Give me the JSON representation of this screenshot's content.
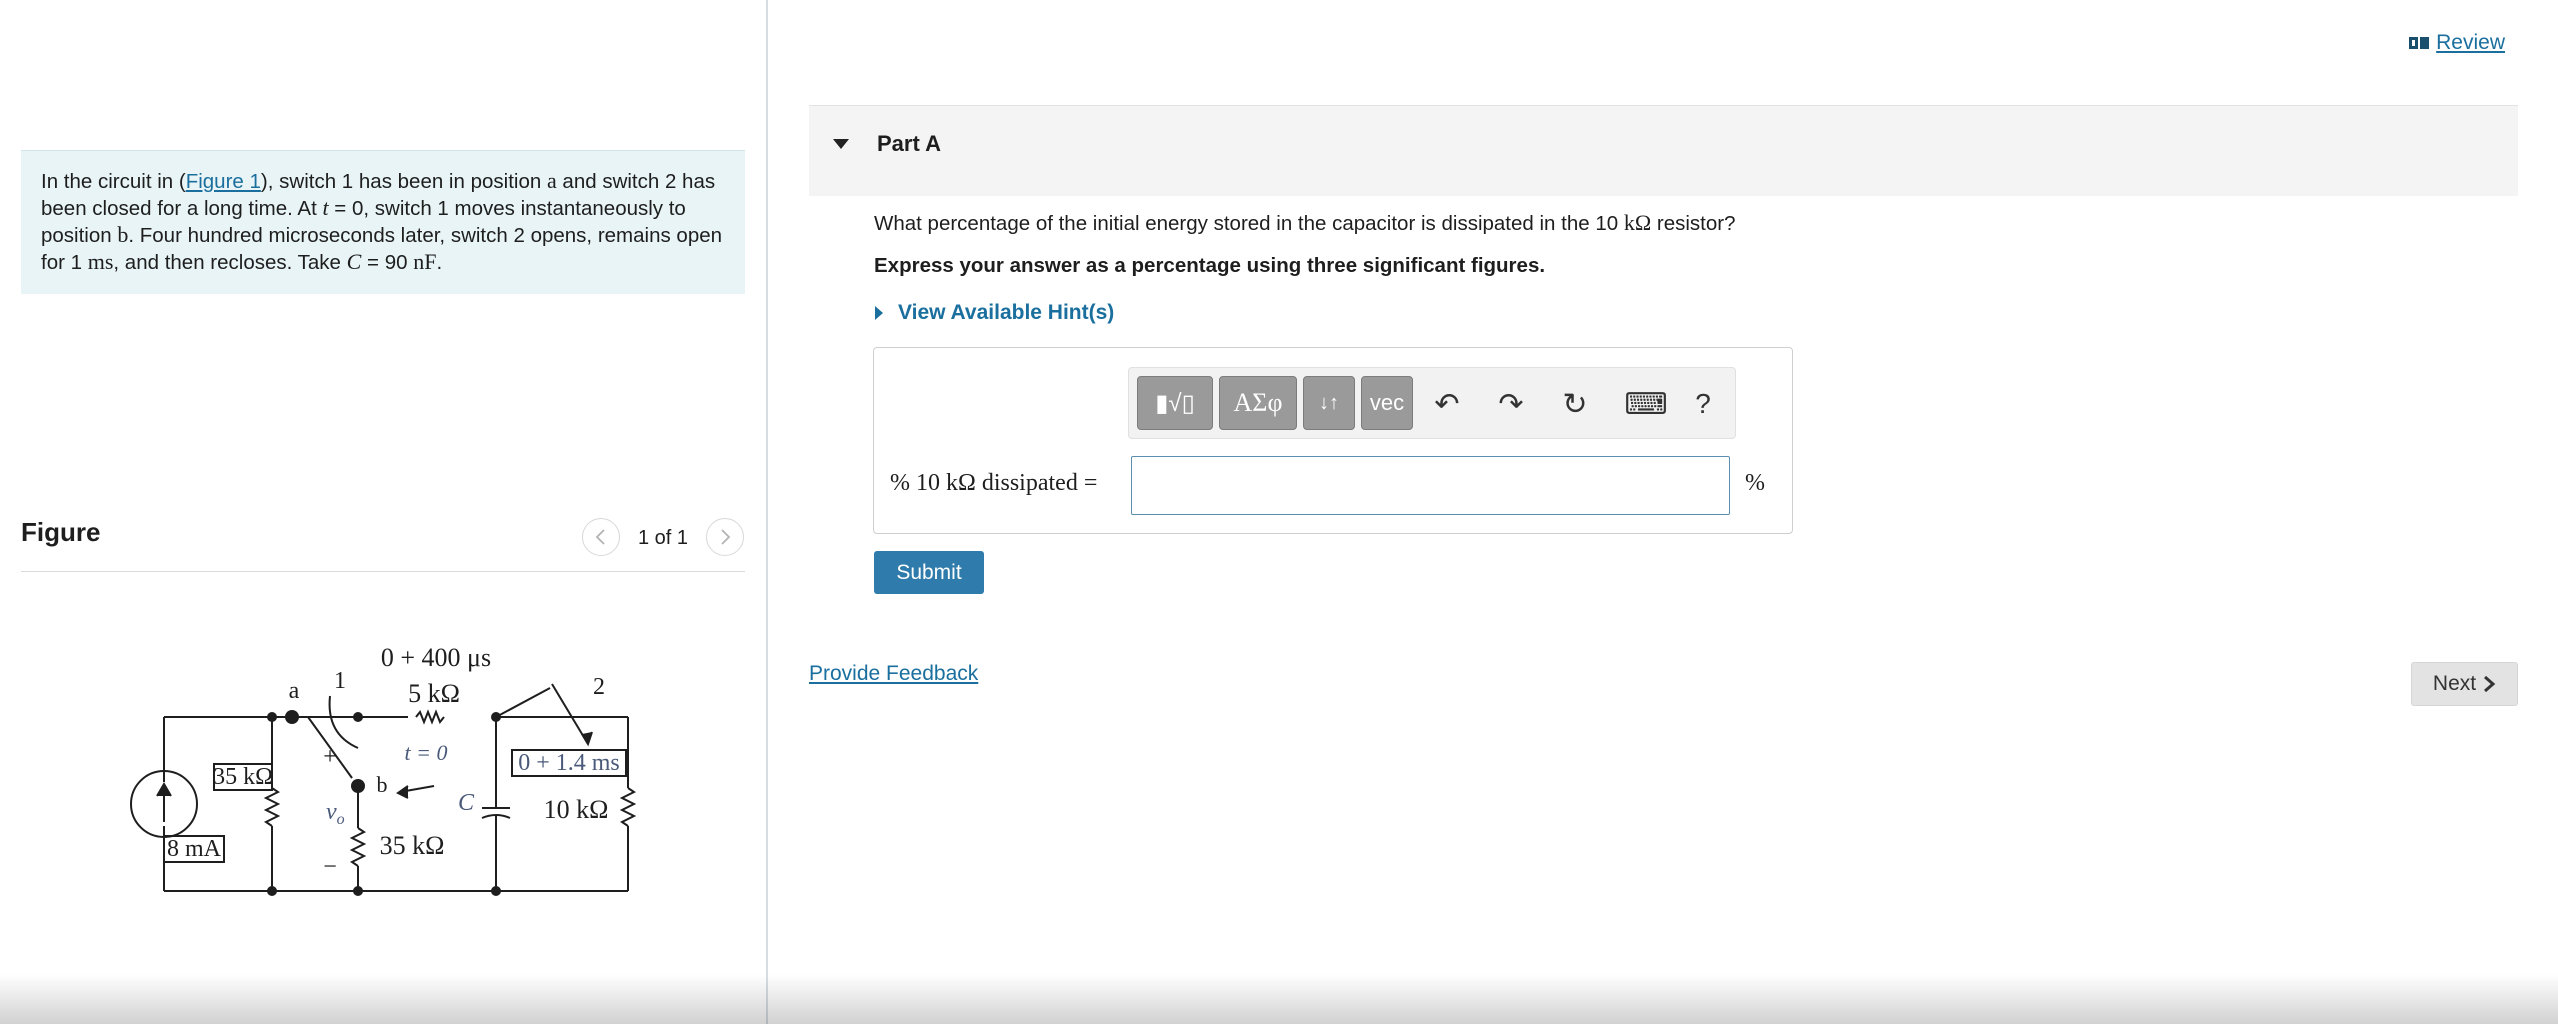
{
  "problem": {
    "text_1": "In the circuit in (",
    "figure_link": "Figure 1",
    "text_2": "), switch 1 has been in position ",
    "pos_a": "a",
    "text_3": " and switch 2 has been closed for a long time. At ",
    "t_var": "t",
    "text_4": " = 0, switch 1 moves instantaneously to position ",
    "pos_b": "b",
    "text_5": ". Four hundred microseconds later, switch 2 opens, remains open for 1 ",
    "unit_ms": "ms",
    "text_6": ", and then recloses. Take ",
    "c_var": "C",
    "text_7": " = 90 ",
    "unit_nf": "nF",
    "text_8": "."
  },
  "figure": {
    "title": "Figure",
    "counter": "1 of 1",
    "labels": {
      "switch2_time": "0 + 400 μs",
      "r1": "5 kΩ",
      "node_a": "a",
      "switch1_pos1": "1",
      "switch2_pos2": "2",
      "t0": "t = 0",
      "plus": "+",
      "node_b": "b",
      "r_left": "35 kΩ",
      "vo": "v",
      "vo_sub": "o",
      "minus": "−",
      "cap": "C",
      "switch2_reclose": "0 + 1.4 ms",
      "r_right": "10 kΩ",
      "r_bottom": "35 kΩ",
      "source": "8 mA"
    }
  },
  "review": {
    "label": "Review"
  },
  "part": {
    "title": "Part A",
    "question_1": "What percentage of the initial energy stored in the capacitor is dissipated in the 10 ",
    "question_unit": "kΩ",
    "question_2": " resistor?",
    "instruction": "Express your answer as a percentage using three significant figures.",
    "hints": "View Available Hint(s)"
  },
  "toolbar": {
    "templates_glyph": "▮√▯",
    "greek_label": "ΑΣφ",
    "arrows_glyph": "↓↑",
    "vec_label": "vec",
    "undo": "↶",
    "redo": "↷",
    "reset": "↻",
    "keyboard": "⌨",
    "help": "?"
  },
  "answer": {
    "label": "% 10 kΩ dissipated =",
    "value": "",
    "unit": "%"
  },
  "buttons": {
    "submit": "Submit",
    "feedback": "Provide Feedback",
    "next": "Next"
  },
  "colors": {
    "link": "#1a6f9e",
    "submit_bg": "#2f7bab",
    "problem_bg": "#e8f4f6",
    "circuit_label": "#4a5a7a"
  }
}
